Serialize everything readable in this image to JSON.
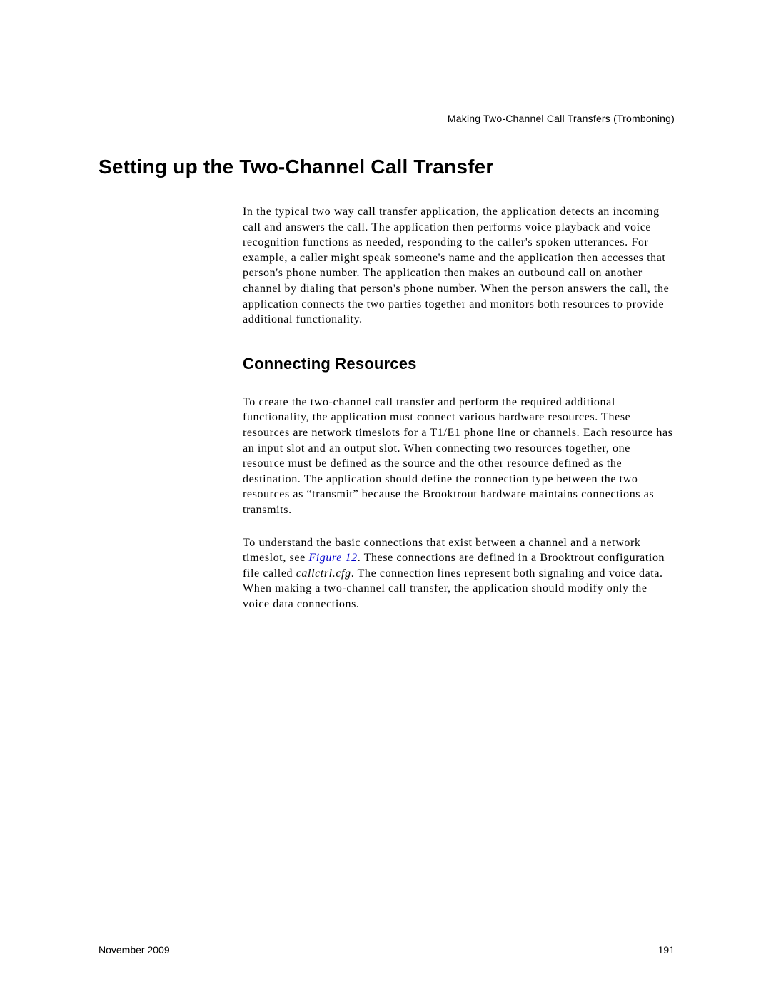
{
  "header": {
    "running_title": "Making Two-Channel Call Transfers (Tromboning)"
  },
  "main": {
    "heading": "Setting up the Two-Channel Call Transfer",
    "intro_para": "In the typical two way call transfer application, the application detects an incoming call and answers the call. The application then performs voice playback and voice recognition functions as needed, responding to the caller's spoken utterances. For example, a caller might speak someone's name and the application then accesses that person's phone number. The application then makes an outbound call on another channel by dialing that person's phone number. When the person answers the call, the application connects the two parties together and monitors both resources to provide additional functionality.",
    "subheading": "Connecting Resources",
    "para_2": "To create the two-channel call transfer and perform the required additional functionality, the application must connect various hardware resources. These resources are network timeslots for a T1/E1 phone line or channels. Each resource has an input slot and an output slot. When connecting two resources together, one resource must be defined as the source and the other resource defined as the destination. The application should define the connection type between the two resources as “transmit” because the Brooktrout hardware maintains connections as transmits.",
    "para_3_before": "To understand the basic connections that exist between a channel and a network timeslot, see ",
    "para_3_link": "Figure 12",
    "para_3_after_link": ". These connections are defined in a Brooktrout configuration file called ",
    "para_3_italic": "callctrl.cfg",
    "para_3_end": ". The connection lines represent both signaling and voice data. When making a two-channel call transfer, the application should modify only the voice data connections."
  },
  "footer": {
    "date": "November 2009",
    "page_number": "191"
  }
}
